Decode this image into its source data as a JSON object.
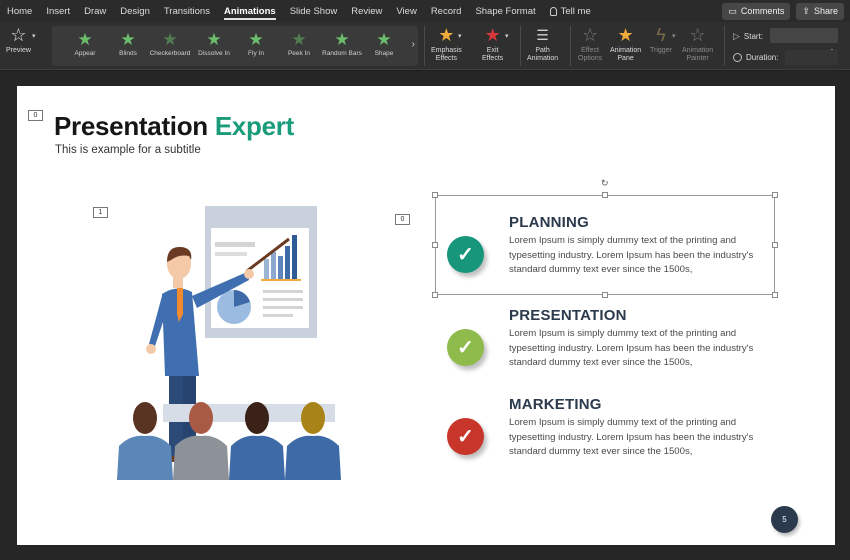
{
  "menubar": {
    "items": [
      "Home",
      "Insert",
      "Draw",
      "Design",
      "Transitions",
      "Animations",
      "Slide Show",
      "Review",
      "View",
      "Record",
      "Shape Format"
    ],
    "active": "Animations",
    "tell_me": "Tell me",
    "comments": "Comments",
    "share": "Share"
  },
  "ribbon": {
    "preview": "Preview",
    "effects": [
      "Appear",
      "Blinds",
      "Checkerboard",
      "Dissolve In",
      "Fly In",
      "Peek In",
      "Random Bars",
      "Shape"
    ],
    "emphasis": [
      "Emphasis",
      "Effects"
    ],
    "exit": [
      "Exit",
      "Effects"
    ],
    "path": [
      "Path",
      "Animation"
    ],
    "effect_options": [
      "Effect",
      "Options"
    ],
    "animation_pane": [
      "Animation",
      "Pane"
    ],
    "trigger": "Trigger",
    "animation_painter": [
      "Animation",
      "Painter"
    ],
    "start_label": "Start:",
    "duration_label": "Duration:"
  },
  "slide": {
    "title_main": "Presentation",
    "title_accent": "Expert",
    "subtitle": "This is example  for a subtitle",
    "anim_tags": [
      "0",
      "1",
      "0"
    ],
    "items": [
      {
        "heading": "PLANNING",
        "body": "Lorem Ipsum is simply dummy text of the printing and typesetting industry. Lorem Ipsum has been the industry's standard dummy text ever since the 1500s,",
        "color": "#17967b"
      },
      {
        "heading": "PRESENTATION",
        "body": "Lorem Ipsum is simply dummy text of the printing and typesetting industry. Lorem Ipsum has been the industry's standard dummy text ever since the 1500s,",
        "color": "#8fba4c"
      },
      {
        "heading": "MARKETING",
        "body": "Lorem Ipsum is simply dummy text of the printing and typesetting industry. Lorem Ipsum has been the industry's standard dummy text ever since the 1500s,",
        "color": "#c8352b"
      }
    ],
    "check_glyph": "✓",
    "page_number": "5"
  },
  "colors": {
    "accent": "#1a9b7c",
    "heading": "#2b3a4d"
  }
}
